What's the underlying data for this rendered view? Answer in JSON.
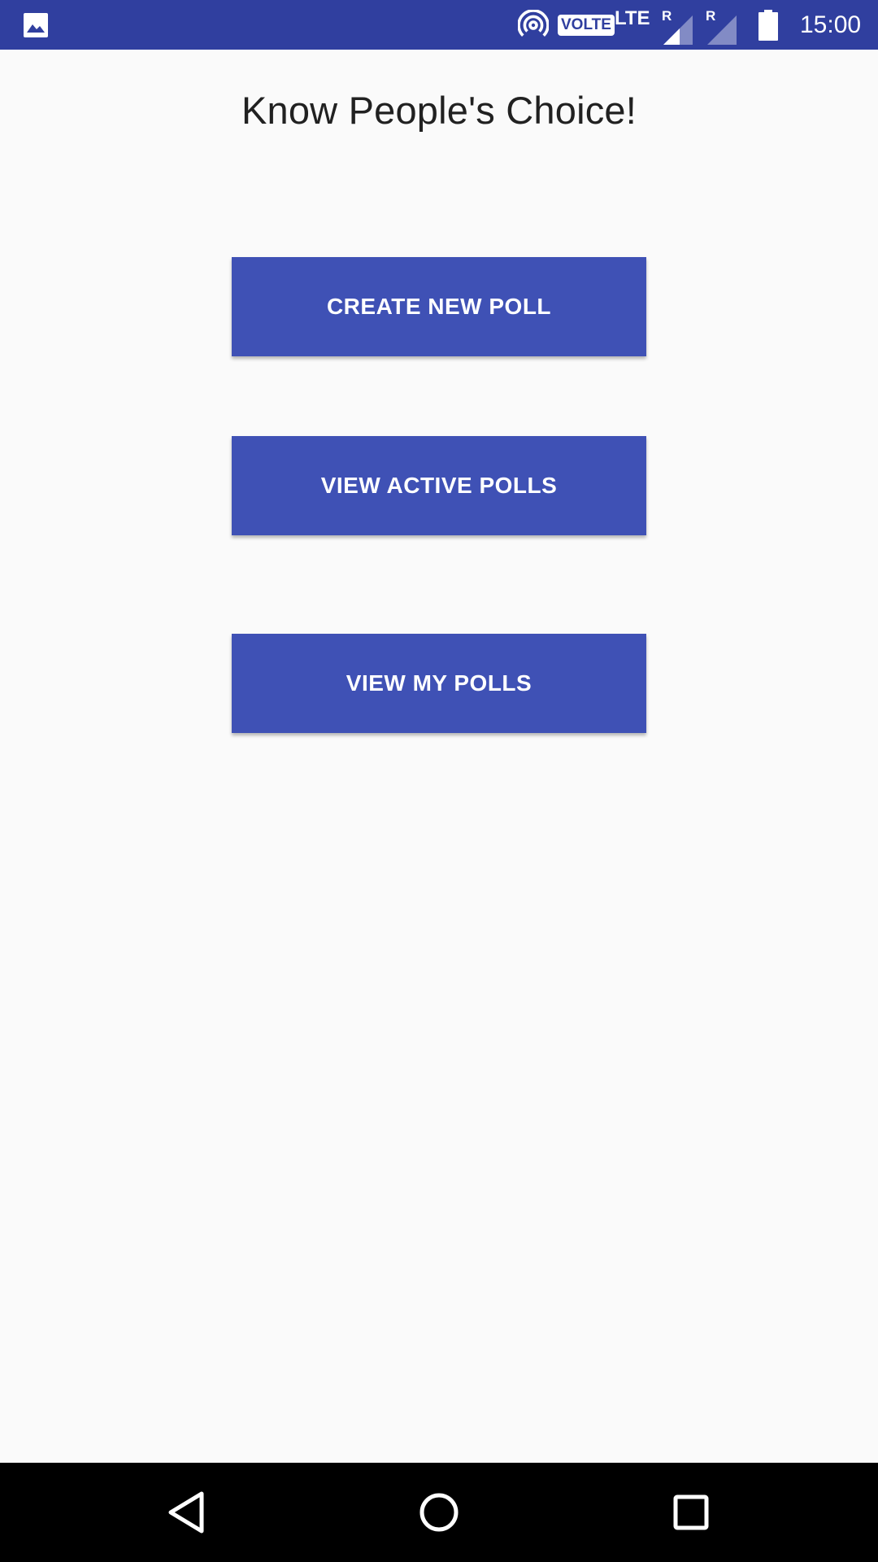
{
  "status_bar": {
    "icons": [
      "gallery-icon",
      "hotspot-icon",
      "volte-badge",
      "lte-indicator",
      "signal-roaming-icon",
      "signal-roaming-icon",
      "battery-icon"
    ],
    "volte_label": "VOLTE",
    "network_label": "LTE",
    "roaming_label_1": "R",
    "roaming_label_2": "R",
    "time": "15:00"
  },
  "main": {
    "title": "Know People's Choice!",
    "buttons": {
      "create_new_poll": "CREATE NEW POLL",
      "view_active_polls": "VIEW ACTIVE POLLS",
      "view_my_polls": "VIEW MY POLLS"
    }
  },
  "nav_bar": {
    "icons": [
      "back-icon",
      "home-icon",
      "recents-icon"
    ]
  },
  "colors": {
    "status_bar": "#303f9f",
    "primary": "#3f51b5",
    "background": "#fafafa",
    "title_text": "#212121",
    "nav_bar": "#000000"
  }
}
